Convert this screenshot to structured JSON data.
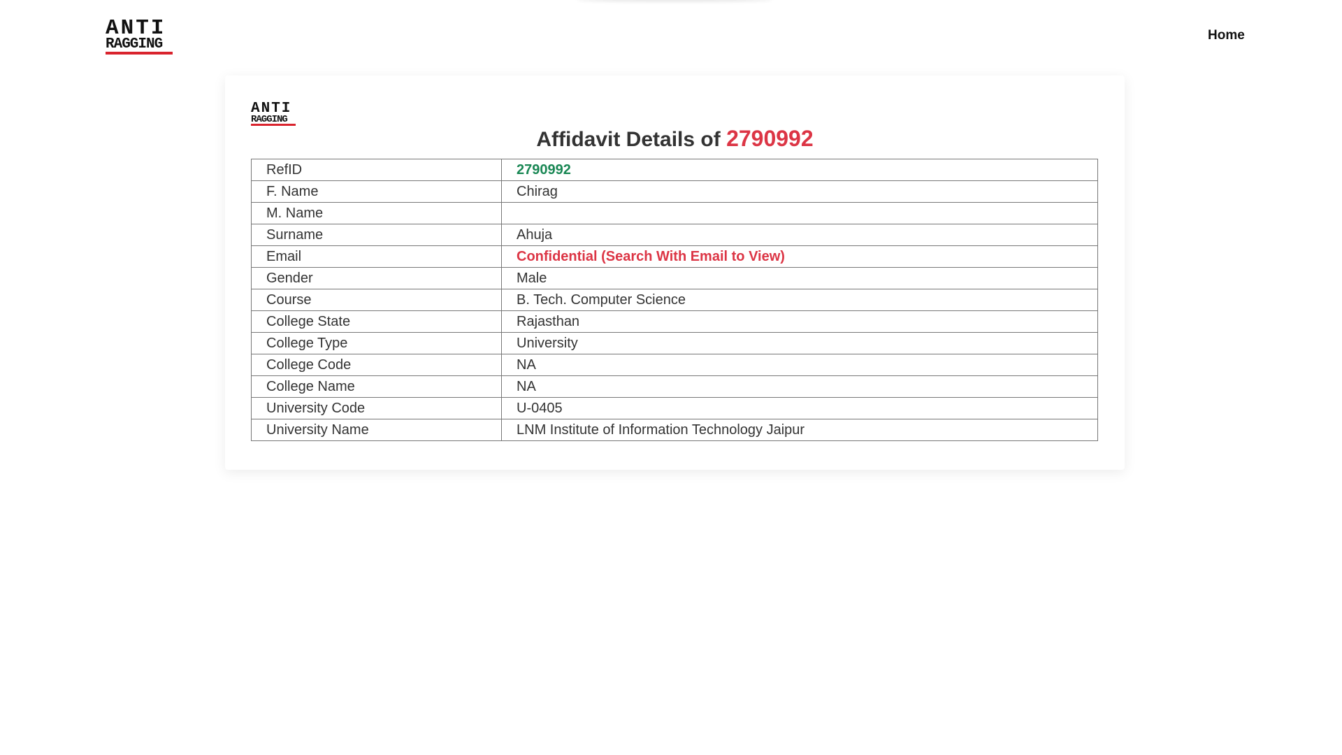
{
  "nav": {
    "logo": {
      "line1": "ANTI",
      "line2": "RAGGING"
    },
    "home_label": "Home"
  },
  "card": {
    "logo": {
      "line1": "ANTI",
      "line2": "RAGGING"
    },
    "title_prefix": "Affidavit Details of",
    "title_ref": "2790992",
    "rows": [
      {
        "label": "RefID",
        "value": "2790992"
      },
      {
        "label": "F. Name",
        "value": "Chirag"
      },
      {
        "label": "M. Name",
        "value": ""
      },
      {
        "label": "Surname",
        "value": "Ahuja"
      },
      {
        "label": "Email",
        "value": "Confidential (Search With Email to View)"
      },
      {
        "label": "Gender",
        "value": "Male"
      },
      {
        "label": "Course",
        "value": "B. Tech. Computer Science"
      },
      {
        "label": "College State",
        "value": "Rajasthan"
      },
      {
        "label": "College Type",
        "value": "University"
      },
      {
        "label": "College Code",
        "value": "NA"
      },
      {
        "label": "College Name",
        "value": "NA"
      },
      {
        "label": "University Code",
        "value": "U-0405"
      },
      {
        "label": "University Name",
        "value": "LNM Institute of Information Technology Jaipur"
      }
    ]
  },
  "colors": {
    "accent_red": "#dc3545",
    "refid_green": "#198754",
    "logo_bar_red": "#d9232d"
  }
}
